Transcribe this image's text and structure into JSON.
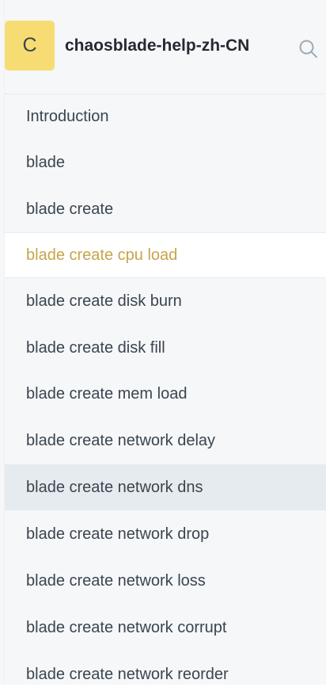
{
  "space": {
    "logo_letter": "C",
    "title": "chaosblade-help-zh-CN"
  },
  "nav": {
    "items": [
      {
        "label": "Introduction",
        "state": "normal"
      },
      {
        "label": "blade",
        "state": "normal"
      },
      {
        "label": "blade create",
        "state": "normal"
      },
      {
        "label": "blade create cpu load",
        "state": "active"
      },
      {
        "label": "blade create disk burn",
        "state": "normal"
      },
      {
        "label": "blade create disk fill",
        "state": "normal"
      },
      {
        "label": "blade create mem load",
        "state": "normal"
      },
      {
        "label": "blade create network delay",
        "state": "normal"
      },
      {
        "label": "blade create network dns",
        "state": "hover"
      },
      {
        "label": "blade create network drop",
        "state": "normal"
      },
      {
        "label": "blade create network loss",
        "state": "normal"
      },
      {
        "label": "blade create network corrupt",
        "state": "normal"
      },
      {
        "label": "blade create network reorder",
        "state": "normal"
      }
    ]
  },
  "colors": {
    "sidebar_background": "#f5f7f9",
    "logo_background": "#f7dc74",
    "active_text": "#c7a549",
    "hover_background": "#e6ebf0",
    "text": "#3b454e"
  },
  "icons": {
    "search": "search-icon"
  }
}
